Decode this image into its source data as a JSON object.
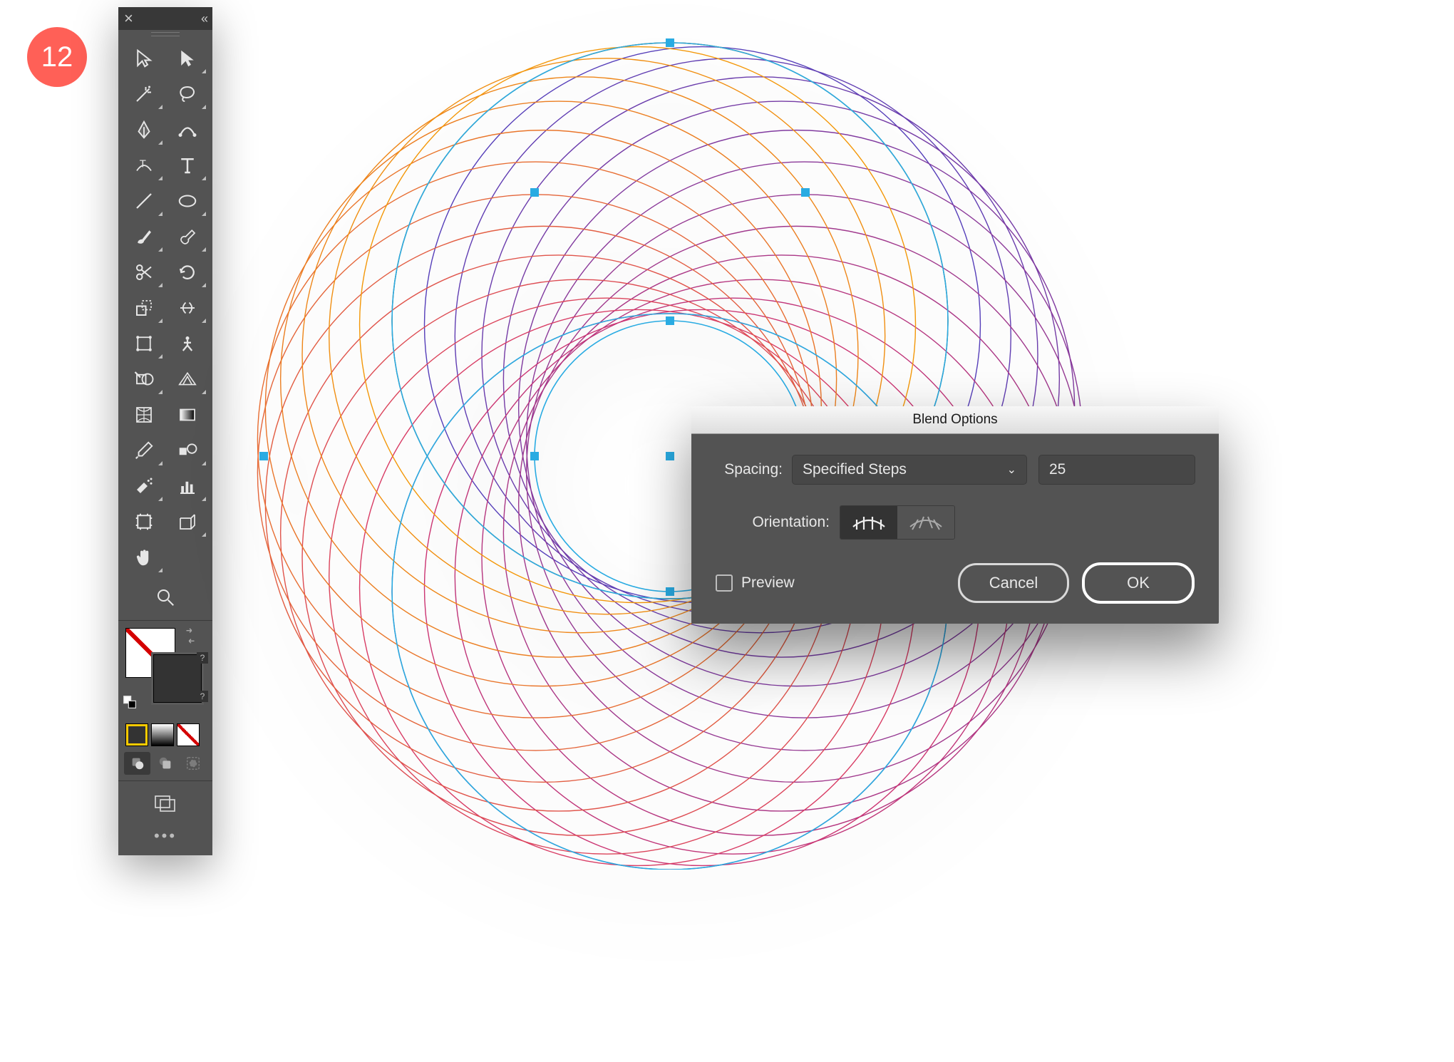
{
  "step_number": "12",
  "toolbar": {
    "tools": [
      {
        "name": "selection-tool",
        "hasSub": false
      },
      {
        "name": "direct-selection-tool",
        "hasSub": true
      },
      {
        "name": "magic-wand-tool",
        "hasSub": true
      },
      {
        "name": "lasso-tool",
        "hasSub": true
      },
      {
        "name": "pen-tool",
        "hasSub": true
      },
      {
        "name": "curvature-tool",
        "hasSub": false
      },
      {
        "name": "type-on-path-tool",
        "hasSub": true
      },
      {
        "name": "type-tool",
        "hasSub": true
      },
      {
        "name": "line-tool",
        "hasSub": true
      },
      {
        "name": "ellipse-tool",
        "hasSub": true
      },
      {
        "name": "paintbrush-tool",
        "hasSub": true
      },
      {
        "name": "blob-brush-tool",
        "hasSub": true
      },
      {
        "name": "scissors-tool",
        "hasSub": true
      },
      {
        "name": "rotate-tool",
        "hasSub": true
      },
      {
        "name": "scale-tool",
        "hasSub": true
      },
      {
        "name": "width-tool",
        "hasSub": true
      },
      {
        "name": "free-transform-tool",
        "hasSub": true
      },
      {
        "name": "puppet-warp-tool",
        "hasSub": false
      },
      {
        "name": "shape-builder-tool",
        "hasSub": true
      },
      {
        "name": "perspective-grid-tool",
        "hasSub": true
      },
      {
        "name": "mesh-tool",
        "hasSub": false
      },
      {
        "name": "gradient-tool",
        "hasSub": false
      },
      {
        "name": "eyedropper-tool",
        "hasSub": true
      },
      {
        "name": "blend-tool",
        "hasSub": true
      },
      {
        "name": "symbol-sprayer-tool",
        "hasSub": true
      },
      {
        "name": "column-graph-tool",
        "hasSub": true
      },
      {
        "name": "artboard-tool",
        "hasSub": false
      },
      {
        "name": "slice-tool",
        "hasSub": true
      },
      {
        "name": "hand-tool",
        "hasSub": true
      },
      {
        "name": "zoom-tool",
        "hasSub": false
      }
    ],
    "swatch": {
      "fill": "none",
      "stroke": "#333333"
    },
    "color_modes": [
      "solid",
      "gradient",
      "none"
    ],
    "draw_modes": [
      "normal",
      "behind",
      "inside"
    ],
    "selected_draw_mode": 0
  },
  "artwork": {
    "blend_steps": 25,
    "colors": {
      "start": "#4a3fbf",
      "mid": "#d6336c",
      "end": "#f59f00"
    },
    "selection_color": "#29abe2"
  },
  "dialog": {
    "title": "Blend Options",
    "spacing_label": "Spacing:",
    "spacing_mode": "Specified Steps",
    "spacing_value": "25",
    "orientation_label": "Orientation:",
    "orientation_selected": 0,
    "preview_label": "Preview",
    "preview_checked": false,
    "cancel_label": "Cancel",
    "ok_label": "OK"
  }
}
